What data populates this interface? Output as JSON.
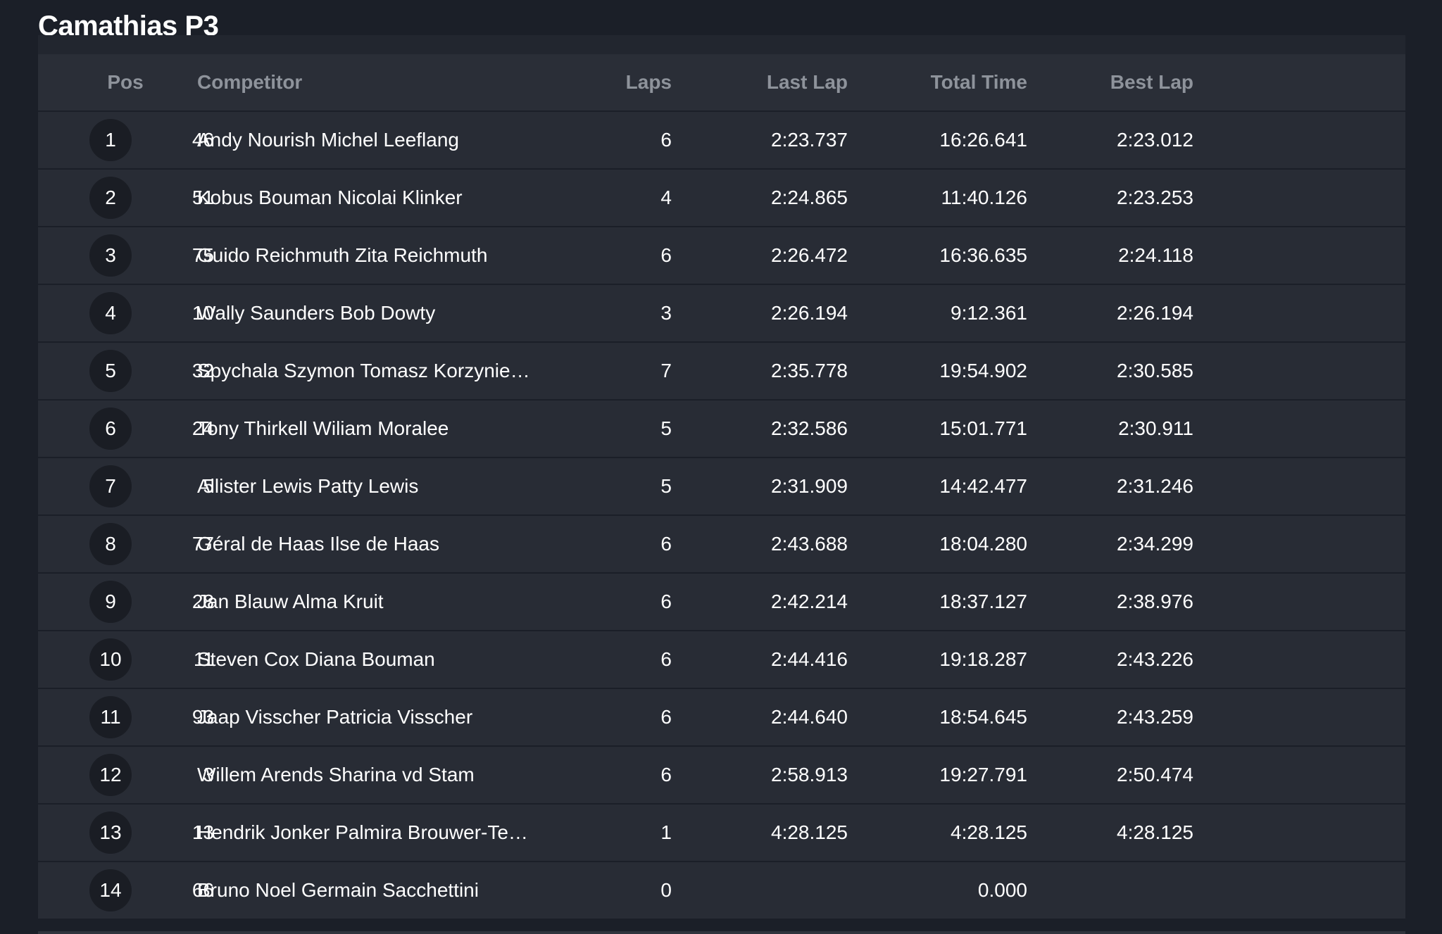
{
  "page_title": "Camathias P3",
  "columns": {
    "pos": "Pos",
    "competitor": "Competitor",
    "laps": "Laps",
    "last_lap": "Last Lap",
    "total_time": "Total Time",
    "best_lap": "Best Lap"
  },
  "rows": [
    {
      "pos": "1",
      "number": "46",
      "competitor": "Andy Nourish Michel Leeflang",
      "laps": "6",
      "last_lap": "2:23.737",
      "total_time": "16:26.641",
      "best_lap": "2:23.012"
    },
    {
      "pos": "2",
      "number": "51",
      "competitor": "Kobus Bouman Nicolai Klinker",
      "laps": "4",
      "last_lap": "2:24.865",
      "total_time": "11:40.126",
      "best_lap": "2:23.253"
    },
    {
      "pos": "3",
      "number": "75",
      "competitor": "Guido Reichmuth Zita Reichmuth",
      "laps": "6",
      "last_lap": "2:26.472",
      "total_time": "16:36.635",
      "best_lap": "2:24.118"
    },
    {
      "pos": "4",
      "number": "10",
      "competitor": "Wally Saunders Bob Dowty",
      "laps": "3",
      "last_lap": "2:26.194",
      "total_time": "9:12.361",
      "best_lap": "2:26.194"
    },
    {
      "pos": "5",
      "number": "32",
      "competitor": "Spychala Szymon Tomasz Korzynie…",
      "laps": "7",
      "last_lap": "2:35.778",
      "total_time": "19:54.902",
      "best_lap": "2:30.585"
    },
    {
      "pos": "6",
      "number": "24",
      "competitor": "Tony Thirkell Wiliam Moralee",
      "laps": "5",
      "last_lap": "2:32.586",
      "total_time": "15:01.771",
      "best_lap": "2:30.911"
    },
    {
      "pos": "7",
      "number": "5",
      "competitor": "Allister Lewis Patty Lewis",
      "laps": "5",
      "last_lap": "2:31.909",
      "total_time": "14:42.477",
      "best_lap": "2:31.246"
    },
    {
      "pos": "8",
      "number": "77",
      "competitor": "Géral de Haas Ilse de Haas",
      "laps": "6",
      "last_lap": "2:43.688",
      "total_time": "18:04.280",
      "best_lap": "2:34.299"
    },
    {
      "pos": "9",
      "number": "28",
      "competitor": "Jan Blauw Alma Kruit",
      "laps": "6",
      "last_lap": "2:42.214",
      "total_time": "18:37.127",
      "best_lap": "2:38.976"
    },
    {
      "pos": "10",
      "number": "11",
      "competitor": "Steven Cox Diana Bouman",
      "laps": "6",
      "last_lap": "2:44.416",
      "total_time": "19:18.287",
      "best_lap": "2:43.226"
    },
    {
      "pos": "11",
      "number": "93",
      "competitor": "Jaap Visscher Patricia Visscher",
      "laps": "6",
      "last_lap": "2:44.640",
      "total_time": "18:54.645",
      "best_lap": "2:43.259"
    },
    {
      "pos": "12",
      "number": "3",
      "competitor": "Willem Arends Sharina vd Stam",
      "laps": "6",
      "last_lap": "2:58.913",
      "total_time": "19:27.791",
      "best_lap": "2:50.474"
    },
    {
      "pos": "13",
      "number": "13",
      "competitor": "Hendrik Jonker Palmira Brouwer-Te…",
      "laps": "1",
      "last_lap": "4:28.125",
      "total_time": "4:28.125",
      "best_lap": "4:28.125"
    },
    {
      "pos": "14",
      "number": "66",
      "competitor": "Bruno Noel Germain Sacchettini",
      "laps": "0",
      "last_lap": "",
      "total_time": "0.000",
      "best_lap": ""
    }
  ]
}
